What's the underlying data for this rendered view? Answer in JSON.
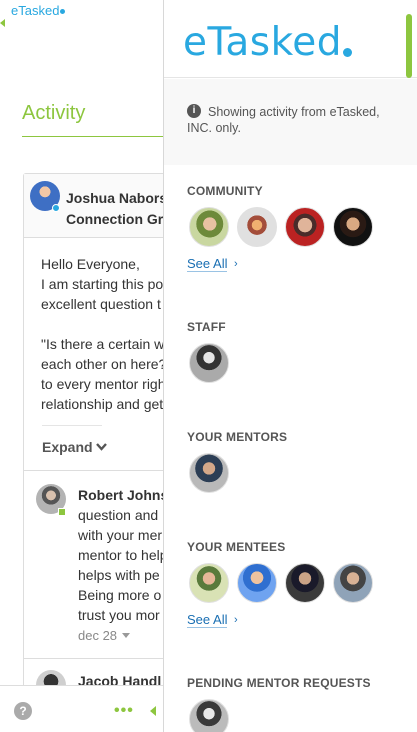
{
  "background": {
    "brand": "eTasked",
    "title": "Activity",
    "post": {
      "author_lines": [
        "Joshua Nabors",
        "Connection Gr"
      ],
      "body_lines": [
        "Hello Everyone,",
        "I am starting this po",
        "excellent question t",
        "",
        "\"Is there a certain w",
        "each other on here?",
        "to every mentor righ",
        "relationship and get"
      ],
      "expand_label": "Expand"
    },
    "comment": {
      "author": "Robert Johns",
      "body_lines": [
        "question and",
        "with your mer",
        "mentor to help",
        "helps with pe",
        "Being more o",
        "trust you mor"
      ],
      "date": "dec 28"
    },
    "comment2": {
      "author": "Jacob Handl"
    },
    "bottom_bar": {
      "help_glyph": "?",
      "more_glyph": "•••"
    }
  },
  "panel": {
    "logo": "eTasked",
    "info": {
      "icon": "i",
      "text": "Showing activity from eTasked, INC. only."
    },
    "sections": {
      "community": {
        "label": "COMMUNITY",
        "see_all": "See All",
        "avatars": [
          "av-a",
          "av-b",
          "av-c",
          "av-d"
        ]
      },
      "staff": {
        "label": "STAFF",
        "avatars": [
          "av-e"
        ]
      },
      "mentors": {
        "label": "YOUR MENTORS",
        "avatars": [
          "av-f"
        ]
      },
      "mentees": {
        "label": "YOUR MENTEES",
        "see_all": "See All",
        "avatars": [
          "av-g",
          "av-h",
          "av-i",
          "av-j"
        ]
      },
      "pending": {
        "label": "PENDING MENTOR REQUESTS",
        "avatars": [
          "av-k"
        ]
      }
    },
    "chevron": "›"
  },
  "colors": {
    "brand_blue": "#29a8e0",
    "accent_green": "#8dc63f",
    "link_blue": "#1a6fb3"
  }
}
